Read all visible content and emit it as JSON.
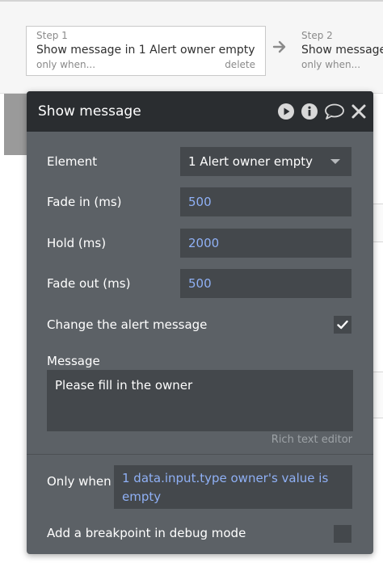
{
  "workflow": {
    "step1": {
      "label": "Step 1",
      "title": "Show message in 1 Alert owner empty",
      "condition": "only when...",
      "delete_label": "delete"
    },
    "step2": {
      "label": "Step 2",
      "title": "Show message",
      "condition": "only when..."
    }
  },
  "panel": {
    "title": "Show message",
    "icons": [
      "play-icon",
      "info-icon",
      "comment-icon",
      "close-icon"
    ],
    "element_label": "Element",
    "element_value": "1 Alert owner empty",
    "fade_in_label": "Fade in (ms)",
    "fade_in_value": "500",
    "hold_label": "Hold (ms)",
    "hold_value": "2000",
    "fade_out_label": "Fade out (ms)",
    "fade_out_value": "500",
    "change_alert_label": "Change the alert message",
    "change_alert_checked": true,
    "message_label": "Message",
    "message_value": "Please fill in the owner",
    "rich_text_label": "Rich text editor",
    "only_when_label": "Only when",
    "only_when_value": "1 data.input.type owner's value is empty",
    "breakpoint_label": "Add a breakpoint in debug mode",
    "breakpoint_checked": false
  },
  "colors": {
    "panel_bg": "#5c6166",
    "header_bg": "#2a2d30",
    "field_bg": "#44484c",
    "dynamic_text": "#8fb0f5"
  }
}
